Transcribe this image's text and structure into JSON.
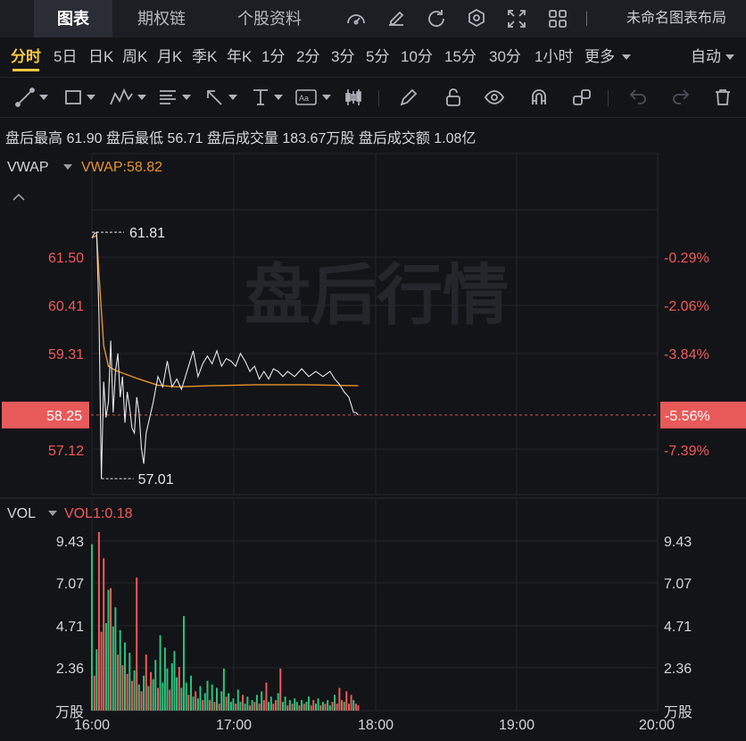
{
  "tabs": [
    {
      "label": "图表",
      "active": true
    },
    {
      "label": "期权链",
      "active": false
    },
    {
      "label": "个股资料",
      "active": false
    }
  ],
  "toolbar_right": {
    "icons": [
      "gauge-icon",
      "edit-icon",
      "refresh-icon",
      "settings-icon",
      "fullscreen-icon",
      "grid-layout-icon"
    ],
    "layout_label": "未命名图表布局"
  },
  "periods": [
    "分时",
    "5日",
    "日K",
    "周K",
    "月K",
    "季K",
    "年K",
    "1分",
    "2分",
    "3分",
    "5分",
    "10分",
    "15分",
    "30分",
    "1小时",
    "更多"
  ],
  "active_period": "分时",
  "scale_mode": "自动",
  "drawing_tools": [
    "line-tool-icon",
    "rectangle-tool-icon",
    "pattern-tool-icon",
    "fibonacci-tool-icon",
    "arrow-tool-icon",
    "measure-tool-icon",
    "text-tool-icon",
    "candle-tool-icon",
    "pencil-icon",
    "lock-icon",
    "eye-icon",
    "magnet-icon",
    "link-icon",
    "undo-icon",
    "redo-icon",
    "trash-icon"
  ],
  "after_hours": {
    "high_label": "盘后最高",
    "high": "61.90",
    "low_label": "盘后最低",
    "low": "56.71",
    "volume_label": "盘后成交量",
    "volume": "183.67万股",
    "turnover_label": "盘后成交额",
    "turnover": "1.08亿"
  },
  "price_panel": {
    "indicator": "VWAP",
    "indicator_value": "VWAP:58.82",
    "watermark": "盘后行情",
    "y_labels": [
      "61.50",
      "60.41",
      "59.31",
      "58.25",
      "57.12"
    ],
    "pct_labels": [
      "-0.29%",
      "-2.06%",
      "-3.84%",
      "-5.56%",
      "-7.39%"
    ],
    "current_price": "58.25",
    "current_pct": "-5.56%",
    "max_marker": "61.81",
    "min_marker": "57.01"
  },
  "volume_panel": {
    "indicator": "VOL",
    "indicator_value": "VOL1:0.18",
    "y_labels": [
      "9.43",
      "7.07",
      "4.71",
      "2.36"
    ],
    "unit": "万股"
  },
  "x_labels": [
    "16:00",
    "17:00",
    "18:00",
    "19:00",
    "20:00"
  ],
  "colors": {
    "up": "#f05a5a",
    "down": "#2ec27e",
    "vwap": "#e8932b",
    "price": "#e6e6e6",
    "accent": "#f5c842"
  },
  "chart_data": {
    "type": "line",
    "x_range": [
      "16:00",
      "20:00"
    ],
    "price_ylim": [
      56.7,
      62.3
    ],
    "price_series": [
      {
        "t": "16:00",
        "v": 61.7
      },
      {
        "t": "16:01",
        "v": 61.78
      },
      {
        "t": "16:02",
        "v": 61.81
      },
      {
        "t": "16:03",
        "v": 60.2
      },
      {
        "t": "16:04",
        "v": 57.01
      },
      {
        "t": "16:05",
        "v": 58.9
      },
      {
        "t": "16:06",
        "v": 58.2
      },
      {
        "t": "16:07",
        "v": 58.5
      },
      {
        "t": "16:08",
        "v": 59.7
      },
      {
        "t": "16:09",
        "v": 58.3
      },
      {
        "t": "16:10",
        "v": 59.1
      },
      {
        "t": "16:11",
        "v": 59.45
      },
      {
        "t": "16:12",
        "v": 58.6
      },
      {
        "t": "16:13",
        "v": 59.0
      },
      {
        "t": "16:14",
        "v": 58.1
      },
      {
        "t": "16:15",
        "v": 58.7
      },
      {
        "t": "16:16",
        "v": 58.4
      },
      {
        "t": "16:17",
        "v": 58.0
      },
      {
        "t": "16:18",
        "v": 57.9
      },
      {
        "t": "16:19",
        "v": 58.6
      },
      {
        "t": "16:20",
        "v": 58.3
      },
      {
        "t": "16:21",
        "v": 57.6
      },
      {
        "t": "16:22",
        "v": 57.3
      },
      {
        "t": "16:23",
        "v": 57.9
      },
      {
        "t": "16:26",
        "v": 58.5
      },
      {
        "t": "16:28",
        "v": 59.0
      },
      {
        "t": "16:30",
        "v": 58.8
      },
      {
        "t": "16:32",
        "v": 59.3
      },
      {
        "t": "16:34",
        "v": 58.8
      },
      {
        "t": "16:36",
        "v": 58.95
      },
      {
        "t": "16:38",
        "v": 58.75
      },
      {
        "t": "16:41",
        "v": 59.2
      },
      {
        "t": "16:43",
        "v": 59.5
      },
      {
        "t": "16:45",
        "v": 59.0
      },
      {
        "t": "16:47",
        "v": 59.25
      },
      {
        "t": "16:49",
        "v": 59.4
      },
      {
        "t": "16:51",
        "v": 59.25
      },
      {
        "t": "16:53",
        "v": 59.5
      },
      {
        "t": "16:55",
        "v": 59.2
      },
      {
        "t": "16:57",
        "v": 59.35
      },
      {
        "t": "16:59",
        "v": 59.3
      },
      {
        "t": "17:01",
        "v": 59.2
      },
      {
        "t": "17:03",
        "v": 59.45
      },
      {
        "t": "17:05",
        "v": 59.3
      },
      {
        "t": "17:07",
        "v": 59.1
      },
      {
        "t": "17:09",
        "v": 59.2
      },
      {
        "t": "17:11",
        "v": 58.95
      },
      {
        "t": "17:13",
        "v": 59.1
      },
      {
        "t": "17:15",
        "v": 58.95
      },
      {
        "t": "17:17",
        "v": 59.15
      },
      {
        "t": "17:19",
        "v": 59.1
      },
      {
        "t": "17:21",
        "v": 59.0
      },
      {
        "t": "17:23",
        "v": 59.1
      },
      {
        "t": "17:26",
        "v": 59.0
      },
      {
        "t": "17:29",
        "v": 59.15
      },
      {
        "t": "17:32",
        "v": 59.0
      },
      {
        "t": "17:35",
        "v": 59.1
      },
      {
        "t": "17:38",
        "v": 59.0
      },
      {
        "t": "17:41",
        "v": 59.1
      },
      {
        "t": "17:43",
        "v": 58.95
      },
      {
        "t": "17:45",
        "v": 58.85
      },
      {
        "t": "17:47",
        "v": 58.7
      },
      {
        "t": "17:49",
        "v": 58.6
      },
      {
        "t": "17:50",
        "v": 58.45
      },
      {
        "t": "17:51",
        "v": 58.3
      },
      {
        "t": "17:52",
        "v": 58.3
      },
      {
        "t": "17:53",
        "v": 58.25
      }
    ],
    "vwap_series": [
      {
        "t": "16:00",
        "v": 61.7
      },
      {
        "t": "16:02",
        "v": 61.75
      },
      {
        "t": "16:03",
        "v": 61.0
      },
      {
        "t": "16:05",
        "v": 59.6
      },
      {
        "t": "16:07",
        "v": 59.2
      },
      {
        "t": "16:10",
        "v": 59.12
      },
      {
        "t": "16:14",
        "v": 59.05
      },
      {
        "t": "16:20",
        "v": 58.95
      },
      {
        "t": "16:28",
        "v": 58.83
      },
      {
        "t": "16:36",
        "v": 58.8
      },
      {
        "t": "16:50",
        "v": 58.82
      },
      {
        "t": "17:10",
        "v": 58.84
      },
      {
        "t": "17:30",
        "v": 58.84
      },
      {
        "t": "17:53",
        "v": 58.82
      }
    ],
    "volume_ylim": [
      0,
      10.5
    ],
    "volume_unit": "万股",
    "volume_bars": [
      {
        "t": "16:00",
        "v": 9.5,
        "dir": "down"
      },
      {
        "t": "16:01",
        "v": 2.0,
        "dir": "up"
      },
      {
        "t": "16:02",
        "v": 3.5,
        "dir": "down"
      },
      {
        "t": "16:03",
        "v": 10.2,
        "dir": "up"
      },
      {
        "t": "16:04",
        "v": 4.5,
        "dir": "up"
      },
      {
        "t": "16:05",
        "v": 8.7,
        "dir": "up"
      },
      {
        "t": "16:06",
        "v": 5.0,
        "dir": "down"
      },
      {
        "t": "16:07",
        "v": 6.9,
        "dir": "down"
      },
      {
        "t": "16:08",
        "v": 7.0,
        "dir": "up"
      },
      {
        "t": "16:09",
        "v": 4.8,
        "dir": "down"
      },
      {
        "t": "16:10",
        "v": 5.9,
        "dir": "down"
      },
      {
        "t": "16:11",
        "v": 3.2,
        "dir": "up"
      },
      {
        "t": "16:12",
        "v": 4.6,
        "dir": "down"
      },
      {
        "t": "16:13",
        "v": 2.6,
        "dir": "up"
      },
      {
        "t": "16:14",
        "v": 3.9,
        "dir": "down"
      },
      {
        "t": "16:15",
        "v": 2.1,
        "dir": "up"
      },
      {
        "t": "16:16",
        "v": 3.3,
        "dir": "down"
      },
      {
        "t": "16:17",
        "v": 1.7,
        "dir": "up"
      },
      {
        "t": "16:18",
        "v": 2.3,
        "dir": "down"
      },
      {
        "t": "16:19",
        "v": 7.6,
        "dir": "up"
      },
      {
        "t": "16:20",
        "v": 1.5,
        "dir": "down"
      },
      {
        "t": "16:21",
        "v": 1.1,
        "dir": "up"
      },
      {
        "t": "16:22",
        "v": 2.0,
        "dir": "down"
      },
      {
        "t": "16:23",
        "v": 3.2,
        "dir": "up"
      },
      {
        "t": "16:24",
        "v": 1.4,
        "dir": "down"
      },
      {
        "t": "16:25",
        "v": 2.2,
        "dir": "up"
      },
      {
        "t": "16:26",
        "v": 1.8,
        "dir": "down"
      },
      {
        "t": "16:27",
        "v": 2.9,
        "dir": "down"
      },
      {
        "t": "16:28",
        "v": 1.3,
        "dir": "up"
      },
      {
        "t": "16:29",
        "v": 4.3,
        "dir": "down"
      },
      {
        "t": "16:30",
        "v": 1.6,
        "dir": "down"
      },
      {
        "t": "16:31",
        "v": 3.6,
        "dir": "down"
      },
      {
        "t": "16:32",
        "v": 2.4,
        "dir": "down"
      },
      {
        "t": "16:33",
        "v": 1.2,
        "dir": "up"
      },
      {
        "t": "16:34",
        "v": 2.7,
        "dir": "down"
      },
      {
        "t": "16:35",
        "v": 3.4,
        "dir": "down"
      },
      {
        "t": "16:36",
        "v": 1.9,
        "dir": "down"
      },
      {
        "t": "16:37",
        "v": 2.5,
        "dir": "up"
      },
      {
        "t": "16:38",
        "v": 1.3,
        "dir": "down"
      },
      {
        "t": "16:39",
        "v": 5.4,
        "dir": "down"
      },
      {
        "t": "16:40",
        "v": 1.6,
        "dir": "down"
      },
      {
        "t": "16:41",
        "v": 0.9,
        "dir": "up"
      },
      {
        "t": "16:42",
        "v": 2.0,
        "dir": "down"
      },
      {
        "t": "16:43",
        "v": 0.8,
        "dir": "down"
      },
      {
        "t": "16:44",
        "v": 1.1,
        "dir": "up"
      },
      {
        "t": "16:45",
        "v": 0.7,
        "dir": "down"
      },
      {
        "t": "16:46",
        "v": 1.4,
        "dir": "down"
      },
      {
        "t": "16:47",
        "v": 0.6,
        "dir": "up"
      },
      {
        "t": "16:48",
        "v": 1.0,
        "dir": "down"
      },
      {
        "t": "16:49",
        "v": 1.7,
        "dir": "down"
      },
      {
        "t": "16:50",
        "v": 0.6,
        "dir": "up"
      },
      {
        "t": "16:51",
        "v": 1.5,
        "dir": "down"
      },
      {
        "t": "16:52",
        "v": 0.5,
        "dir": "up"
      },
      {
        "t": "16:53",
        "v": 1.3,
        "dir": "down"
      },
      {
        "t": "16:54",
        "v": 0.4,
        "dir": "up"
      },
      {
        "t": "16:55",
        "v": 1.1,
        "dir": "down"
      },
      {
        "t": "16:56",
        "v": 2.4,
        "dir": "down"
      },
      {
        "t": "16:57",
        "v": 0.8,
        "dir": "up"
      },
      {
        "t": "16:58",
        "v": 1.0,
        "dir": "down"
      },
      {
        "t": "16:59",
        "v": 0.5,
        "dir": "down"
      },
      {
        "t": "17:00",
        "v": 0.7,
        "dir": "down"
      },
      {
        "t": "17:01",
        "v": 0.4,
        "dir": "up"
      },
      {
        "t": "17:02",
        "v": 1.2,
        "dir": "down"
      },
      {
        "t": "17:03",
        "v": 0.5,
        "dir": "down"
      },
      {
        "t": "17:04",
        "v": 0.9,
        "dir": "up"
      },
      {
        "t": "17:05",
        "v": 0.4,
        "dir": "down"
      },
      {
        "t": "17:06",
        "v": 0.8,
        "dir": "down"
      },
      {
        "t": "17:07",
        "v": 0.3,
        "dir": "up"
      },
      {
        "t": "17:08",
        "v": 0.6,
        "dir": "down"
      },
      {
        "t": "17:09",
        "v": 0.5,
        "dir": "up"
      },
      {
        "t": "17:10",
        "v": 0.9,
        "dir": "down"
      },
      {
        "t": "17:11",
        "v": 0.4,
        "dir": "up"
      },
      {
        "t": "17:12",
        "v": 1.1,
        "dir": "down"
      },
      {
        "t": "17:13",
        "v": 0.6,
        "dir": "up"
      },
      {
        "t": "17:14",
        "v": 1.6,
        "dir": "up"
      },
      {
        "t": "17:15",
        "v": 0.5,
        "dir": "down"
      },
      {
        "t": "17:16",
        "v": 0.8,
        "dir": "down"
      },
      {
        "t": "17:17",
        "v": 0.4,
        "dir": "up"
      },
      {
        "t": "17:18",
        "v": 0.6,
        "dir": "up"
      },
      {
        "t": "17:19",
        "v": 1.0,
        "dir": "down"
      },
      {
        "t": "17:20",
        "v": 2.4,
        "dir": "up"
      },
      {
        "t": "17:21",
        "v": 0.5,
        "dir": "down"
      },
      {
        "t": "17:22",
        "v": 0.8,
        "dir": "down"
      },
      {
        "t": "17:23",
        "v": 0.3,
        "dir": "up"
      },
      {
        "t": "17:24",
        "v": 0.6,
        "dir": "down"
      },
      {
        "t": "17:25",
        "v": 0.4,
        "dir": "up"
      },
      {
        "t": "17:26",
        "v": 0.7,
        "dir": "down"
      },
      {
        "t": "17:27",
        "v": 0.5,
        "dir": "down"
      },
      {
        "t": "17:28",
        "v": 0.3,
        "dir": "up"
      },
      {
        "t": "17:29",
        "v": 0.6,
        "dir": "down"
      },
      {
        "t": "17:30",
        "v": 0.4,
        "dir": "up"
      },
      {
        "t": "17:31",
        "v": 0.5,
        "dir": "down"
      },
      {
        "t": "17:32",
        "v": 0.8,
        "dir": "down"
      },
      {
        "t": "17:33",
        "v": 0.3,
        "dir": "up"
      },
      {
        "t": "17:34",
        "v": 0.6,
        "dir": "up"
      },
      {
        "t": "17:35",
        "v": 0.4,
        "dir": "down"
      },
      {
        "t": "17:36",
        "v": 0.7,
        "dir": "down"
      },
      {
        "t": "17:37",
        "v": 0.3,
        "dir": "up"
      },
      {
        "t": "17:38",
        "v": 0.5,
        "dir": "down"
      },
      {
        "t": "17:39",
        "v": 0.4,
        "dir": "up"
      },
      {
        "t": "17:40",
        "v": 0.6,
        "dir": "down"
      },
      {
        "t": "17:41",
        "v": 0.3,
        "dir": "down"
      },
      {
        "t": "17:42",
        "v": 0.5,
        "dir": "up"
      },
      {
        "t": "17:43",
        "v": 0.9,
        "dir": "down"
      },
      {
        "t": "17:44",
        "v": 0.4,
        "dir": "up"
      },
      {
        "t": "17:45",
        "v": 1.3,
        "dir": "up"
      },
      {
        "t": "17:46",
        "v": 0.6,
        "dir": "up"
      },
      {
        "t": "17:47",
        "v": 0.5,
        "dir": "down"
      },
      {
        "t": "17:48",
        "v": 1.1,
        "dir": "up"
      },
      {
        "t": "17:49",
        "v": 0.4,
        "dir": "up"
      },
      {
        "t": "17:50",
        "v": 0.9,
        "dir": "up"
      },
      {
        "t": "17:51",
        "v": 0.6,
        "dir": "down"
      },
      {
        "t": "17:52",
        "v": 0.4,
        "dir": "up"
      },
      {
        "t": "17:53",
        "v": 0.3,
        "dir": "up"
      }
    ]
  }
}
